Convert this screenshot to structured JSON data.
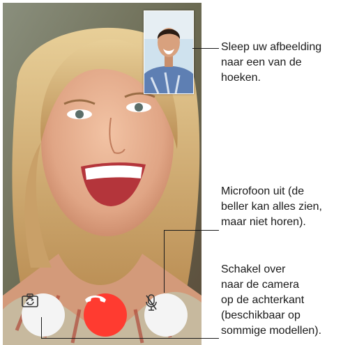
{
  "callouts": {
    "pip": [
      "Sleep uw afbeelding",
      "naar een van de",
      "hoeken."
    ],
    "mute": [
      "Microfoon uit (de",
      "beller kan alles zien,",
      "maar niet horen)."
    ],
    "flip": [
      "Schakel over",
      "naar de camera",
      "op de achterkant",
      "(beschikbaar op",
      "sommige modellen)."
    ]
  },
  "controls": {
    "flip_icon": "camera-flip-icon",
    "end_icon": "phone-end-icon",
    "mute_icon": "microphone-off-icon"
  },
  "colors": {
    "end_call": "#ff3b30",
    "control_bg": "#f4f4f4",
    "callout_text": "#1a1a1a"
  }
}
